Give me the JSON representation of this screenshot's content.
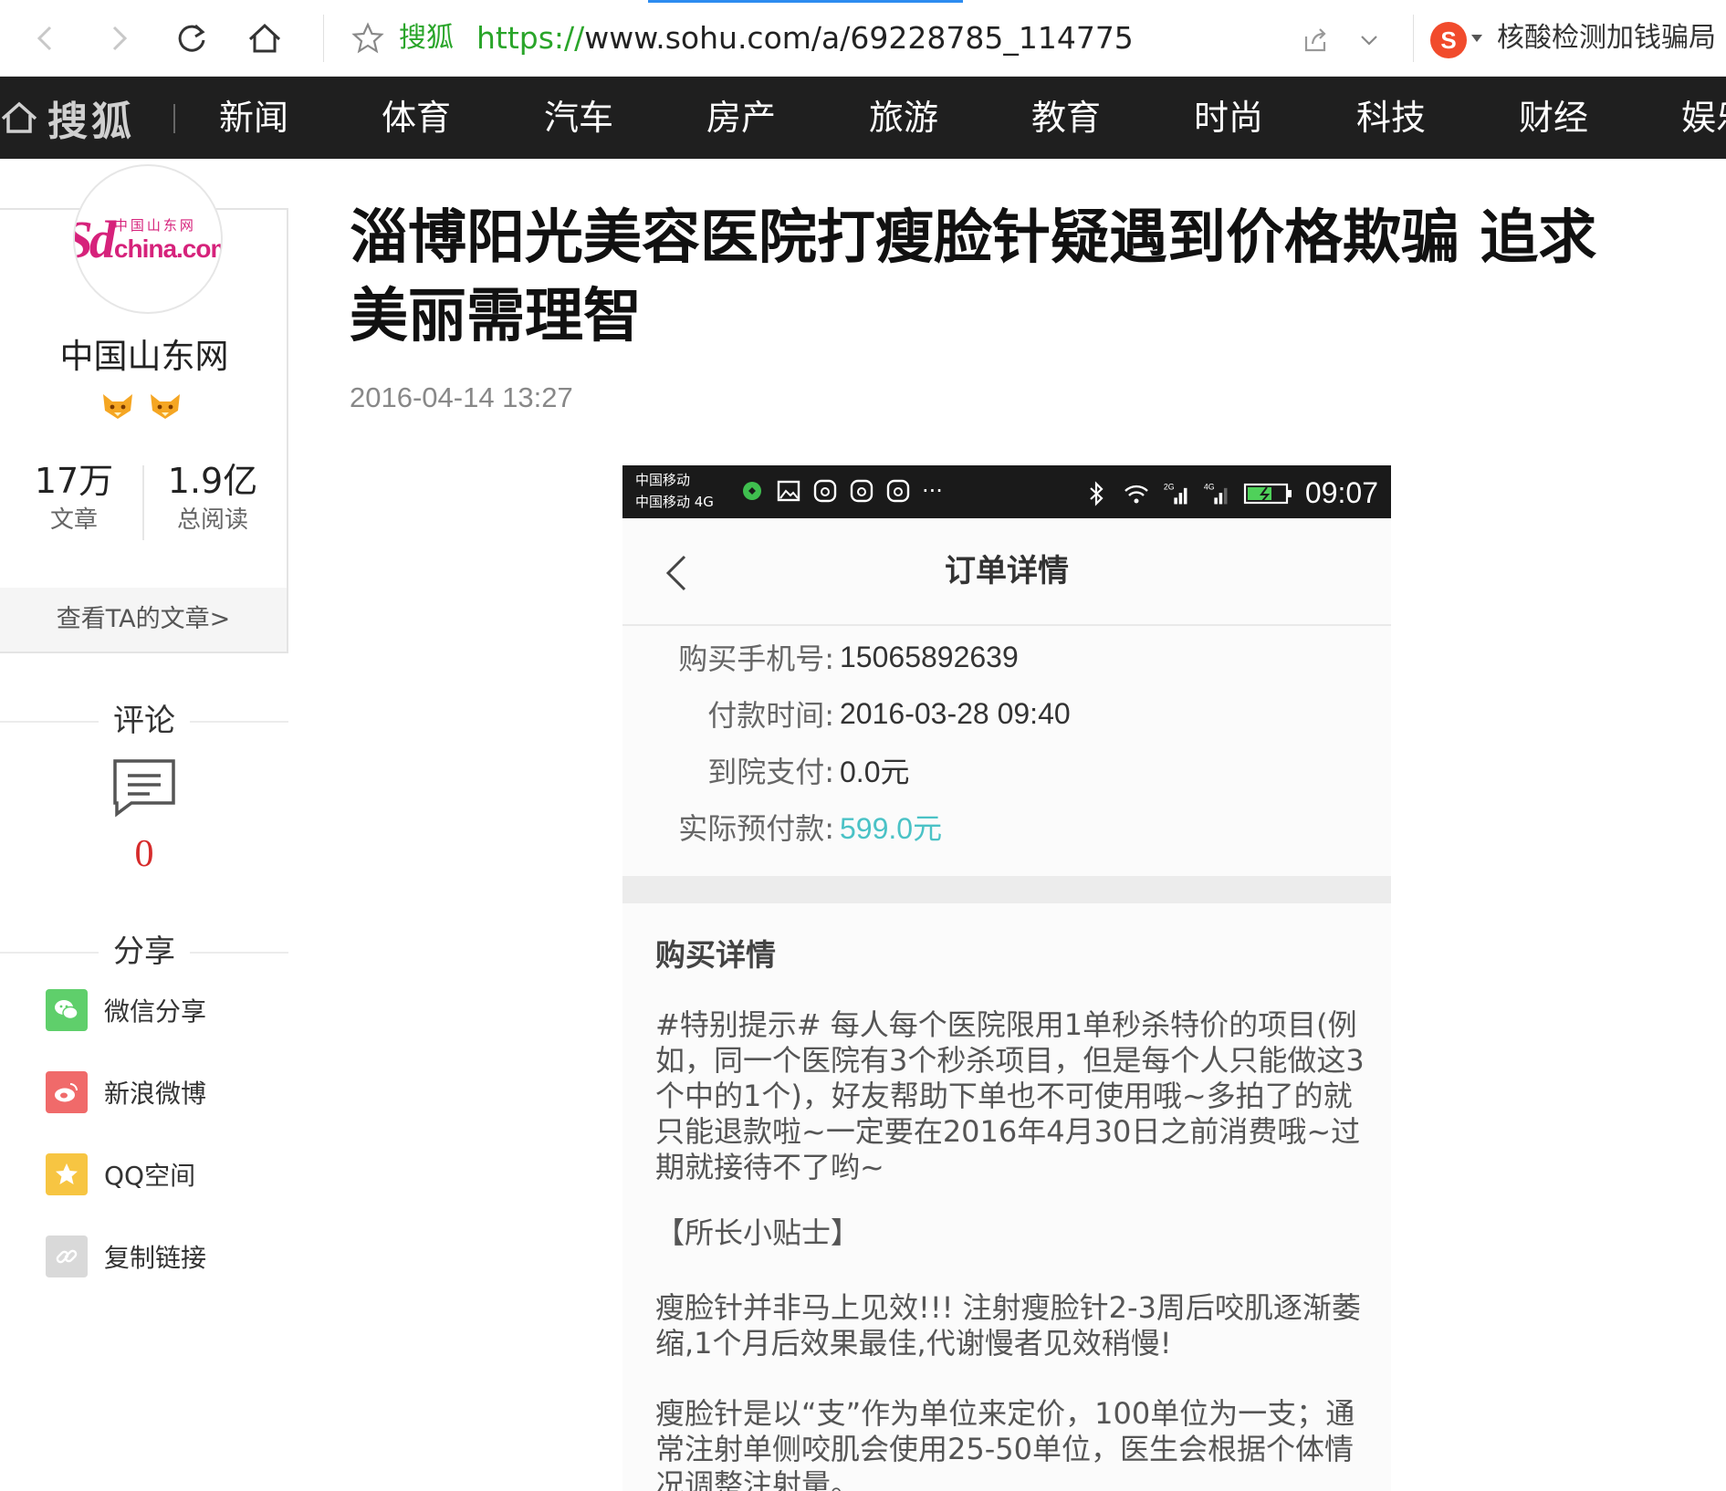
{
  "browser": {
    "site_name": "搜狐",
    "url_protocol": "https://",
    "url_rest": "www.sohu.com/a/69228785_114775",
    "search_hint": "核酸检测加钱骗局",
    "sogou_letter": "S",
    "icons": [
      "back-icon",
      "forward-icon",
      "refresh-icon",
      "home-icon",
      "star-icon",
      "share-icon",
      "dropdown-icon"
    ]
  },
  "sohu_nav": {
    "logo_text": "搜狐",
    "items": [
      "新闻",
      "体育",
      "汽车",
      "房产",
      "旅游",
      "教育",
      "时尚",
      "科技",
      "财经",
      "娱乐"
    ]
  },
  "author": {
    "logo_main": "Sd",
    "logo_cn": "中国山东网",
    "logo_com": "china.com",
    "name": "中国山东网",
    "stats": [
      {
        "value": "17万",
        "label": "文章"
      },
      {
        "value": "1.9亿",
        "label": "总阅读"
      }
    ],
    "view_link": "查看TA的文章>"
  },
  "comments": {
    "title": "评论",
    "count": "0"
  },
  "share": {
    "title": "分享",
    "items": [
      {
        "label": "微信分享",
        "icon": "wechat-icon",
        "color": "#5fcf6b"
      },
      {
        "label": "新浪微博",
        "icon": "weibo-icon",
        "color": "#f06a6a"
      },
      {
        "label": "QQ空间",
        "icon": "qzone-icon",
        "color": "#f7c542"
      },
      {
        "label": "复制链接",
        "icon": "link-icon",
        "color": "#d9d9d9"
      }
    ]
  },
  "article": {
    "title": "淄博阳光美容医院打瘦脸针疑遇到价格欺骗 追求美丽需理智",
    "date": "2016-04-14 13:27"
  },
  "phone": {
    "carrier_line1": "中国移动",
    "carrier_line2": "中国移动 4G",
    "time": "09:07",
    "net_2g": "2G",
    "net_4g": "4G",
    "order_title": "订单详情",
    "fields": [
      {
        "key": "购买手机号:",
        "value": "15065892639"
      },
      {
        "key": "付款时间:",
        "value": "2016-03-28 09:40"
      },
      {
        "key": "到院支付:",
        "value": "0.0元"
      },
      {
        "key": "实际预付款:",
        "value": "599.0元"
      }
    ],
    "buy_title": "购买详情",
    "paragraphs": [
      "#特别提示# 每人每个医院限用1单秒杀特价的项目(例如，同一个医院有3个秒杀项目，但是每个人只能做这3个中的1个)，好友帮助下单也不可使用哦~多拍了的就只能退款啦~一定要在2016年4月30日之前消费哦~过期就接待不了哟~",
      "【所长小贴士】",
      "瘦脸针并非马上见效!!! 注射瘦脸针2-3周后咬肌逐渐萎缩,1个月后效果最佳,代谢慢者见效稍慢!",
      "瘦脸针是以“支”作为单位来定价，100单位为一支；通常注射单侧咬肌会使用25-50单位，医生会根据个体情况调整注射量。"
    ]
  },
  "colors": {
    "accent_green": "#2aa52a",
    "nav_bg": "#1f1f1f",
    "price_accent": "#4ac2c6",
    "comment_count": "#d62b2b"
  }
}
